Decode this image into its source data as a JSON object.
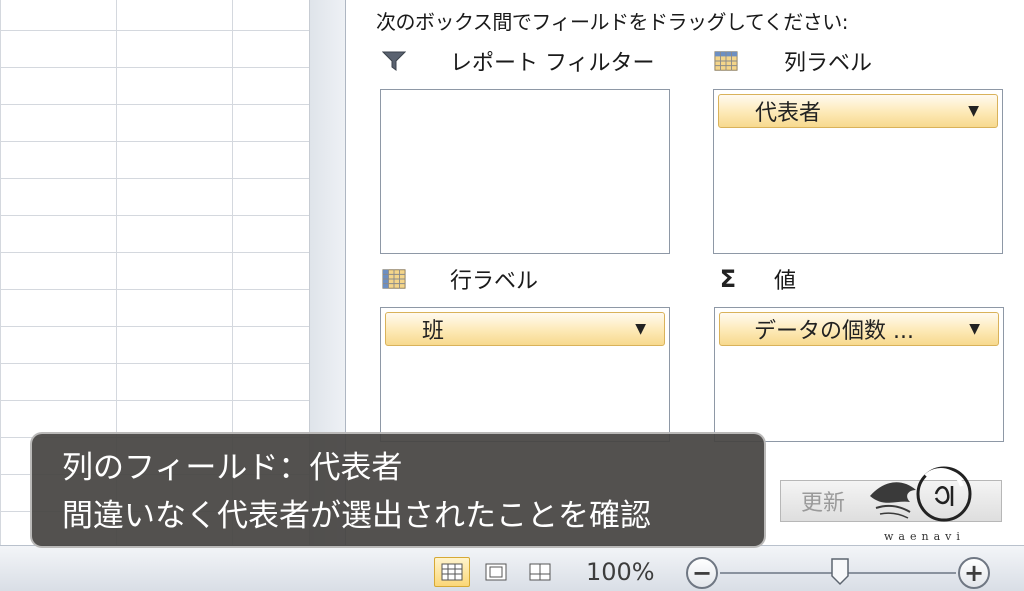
{
  "pivot_pane": {
    "instruction": "次のボックス間でフィールドをドラッグしてください:",
    "areas": {
      "report_filter": {
        "label": "レポート フィルター",
        "icon": "filter-icon",
        "fields": []
      },
      "column_labels": {
        "label": "列ラベル",
        "icon": "table-icon",
        "fields": [
          {
            "name": "代表者"
          }
        ]
      },
      "row_labels": {
        "label": "行ラベル",
        "icon": "table-icon",
        "fields": [
          {
            "name": "班"
          }
        ]
      },
      "values": {
        "label": "値",
        "icon": "sigma-icon",
        "fields": [
          {
            "name": "データの個数 ..."
          }
        ]
      }
    },
    "update_button": "更新"
  },
  "caption": {
    "line1": "列のフィールド：代表者",
    "line2": "間違いなく代表者が選出されたことを確認"
  },
  "statusbar": {
    "zoom_level": "100%",
    "zoom_value": 100
  },
  "logo": {
    "text": "waenavi"
  },
  "colors": {
    "chip_fill": "#fde9b6",
    "chip_border": "#d9b25a",
    "caption_bg": "#464442"
  }
}
